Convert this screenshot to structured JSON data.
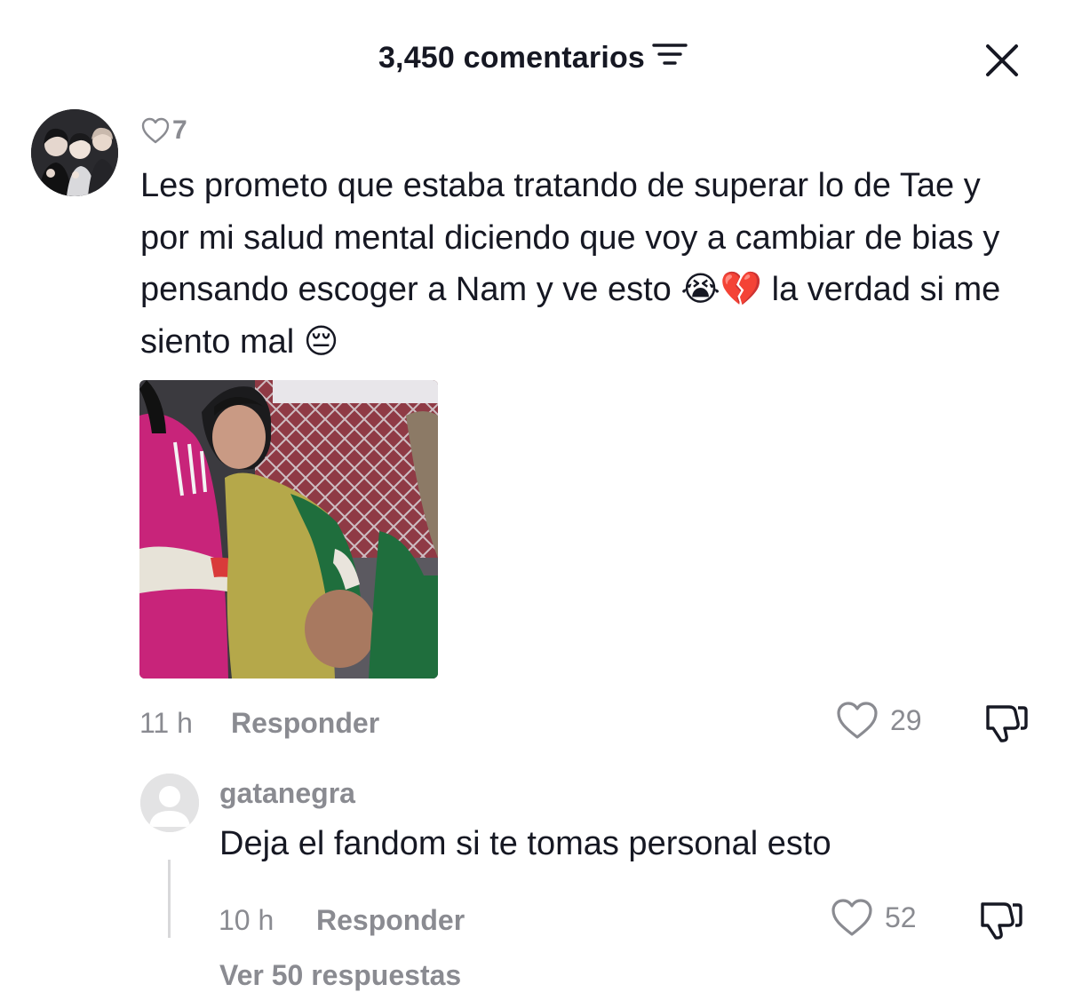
{
  "header": {
    "title": "3,450 comentarios",
    "filter_icon": "filter-icon",
    "close_icon": "close-icon"
  },
  "comment": {
    "like_count": "7",
    "text": "Les prometo que estaba tratando de superar lo de Tae y por mi salud mental diciendo que voy a cambiar de bias y pensando escoger a Nam y ve esto 😭💔 la verdad si me siento mal 😔",
    "time": "11 h",
    "reply_label": "Responder",
    "likes": "29"
  },
  "reply": {
    "username": "gatanegra",
    "text": "Deja el fandom si te tomas personal esto",
    "time": "10 h",
    "reply_label": "Responder",
    "likes": "52",
    "more_replies": "Ver 50 respuestas"
  },
  "colors": {
    "text": "#161823",
    "muted": "#8a8b91",
    "background": "#ffffff"
  }
}
